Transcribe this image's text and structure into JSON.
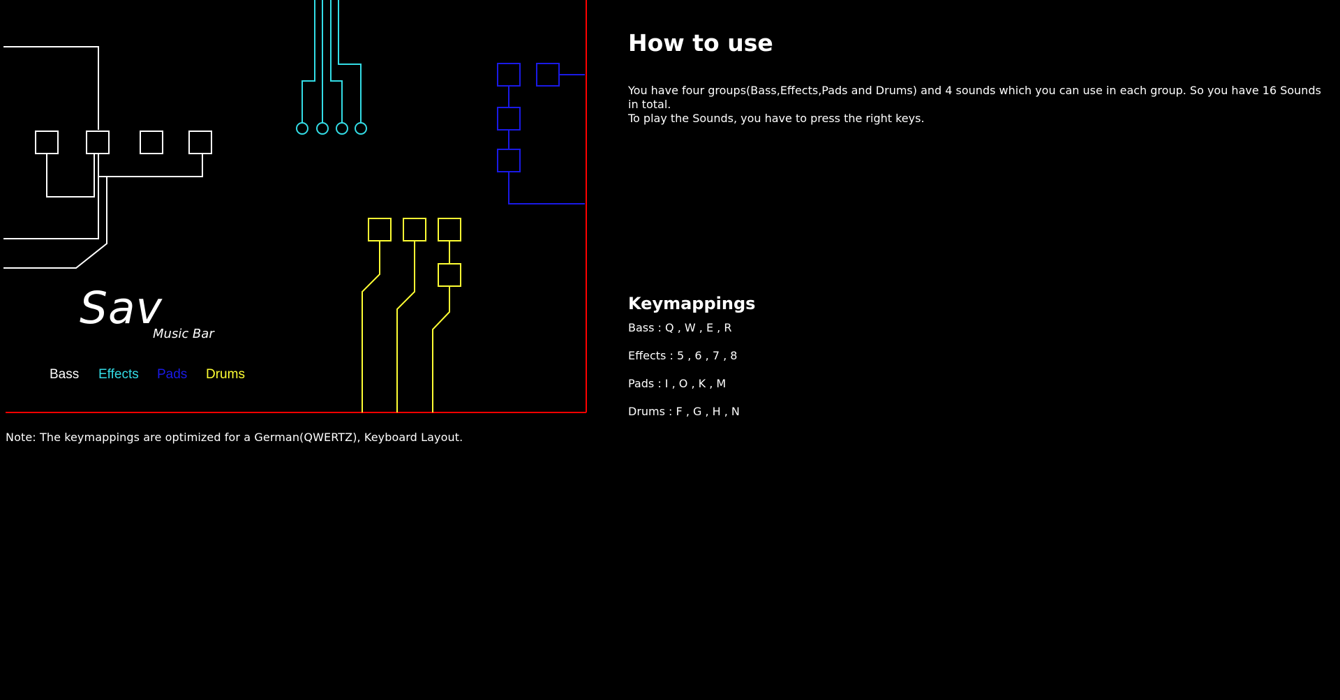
{
  "board": {
    "colors": {
      "bass": "#ffffff",
      "effects": "#33dde6",
      "pads": "#1a1ae6",
      "drums": "#ffff33",
      "frame": "#ff0000"
    },
    "logo": {
      "title": "Sav",
      "subtitle": "Music Bar"
    },
    "legend": {
      "bass": "Bass",
      "effects": "Effects",
      "pads": "Pads",
      "drums": "Drums"
    }
  },
  "note": "Note: The keymappings are optimized for a German(QWERTZ), Keyboard Layout.",
  "help": {
    "title": "How to use",
    "line1": "You have four groups(Bass,Effects,Pads and Drums) and 4 sounds which you can use in each group. So you have 16 Sounds in total.",
    "line2": "To play the Sounds, you have to press the right keys."
  },
  "keymappings": {
    "title": "Keymappings",
    "rows": [
      "Bass : Q , W , E , R",
      "Effects : 5 , 6 , 7 , 8",
      "Pads : I , O , K , M",
      "Drums : F , G , H , N"
    ]
  }
}
